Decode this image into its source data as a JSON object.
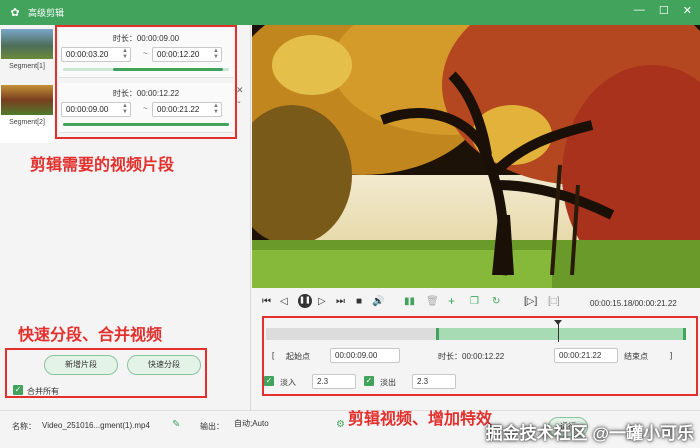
{
  "window": {
    "title": "高级剪辑",
    "minimize": "—",
    "maximize": "☐",
    "close": "✕"
  },
  "segments": [
    {
      "label": "Segment[1]",
      "duration": "时长：00:00:09.00",
      "start": "00:00:03.20",
      "end": "00:00:12.20"
    },
    {
      "label": "Segment[2]",
      "duration": "时长：00:00:12.22",
      "start": "00:00:09.00",
      "end": "00:00:21.22"
    }
  ],
  "annotations": {
    "segments_note": "剪辑需要的视频片段",
    "split_merge_note": "快速分段、合并视频",
    "edit_note": "剪辑视频、增加特效"
  },
  "left_actions": {
    "add_segment": "新增片段",
    "quick_split": "快速分段",
    "merge_all": "合并所有"
  },
  "player": {
    "time": "00:00:15.18/00:00:21.22"
  },
  "trim": {
    "start_label": "起始点",
    "start_value": "00:00:09.00",
    "duration": "时长：00:00:12.22",
    "end_value": "00:00:21.22",
    "end_label": "结束点"
  },
  "effects": {
    "fade_in_label": "淡入",
    "fade_in_value": "2.3",
    "fade_out_label": "淡出",
    "fade_out_value": "2.3"
  },
  "bottom": {
    "name_label": "名称：",
    "name_value": "Video_251016...gment(1).mp4",
    "output_label": "输出：",
    "output_value": "自动;Auto",
    "run_label": "运行"
  },
  "watermark": "掘金技术社区 @一罐小可乐",
  "colors": {
    "accent": "#41a35c",
    "annotation": "#e2302d"
  }
}
